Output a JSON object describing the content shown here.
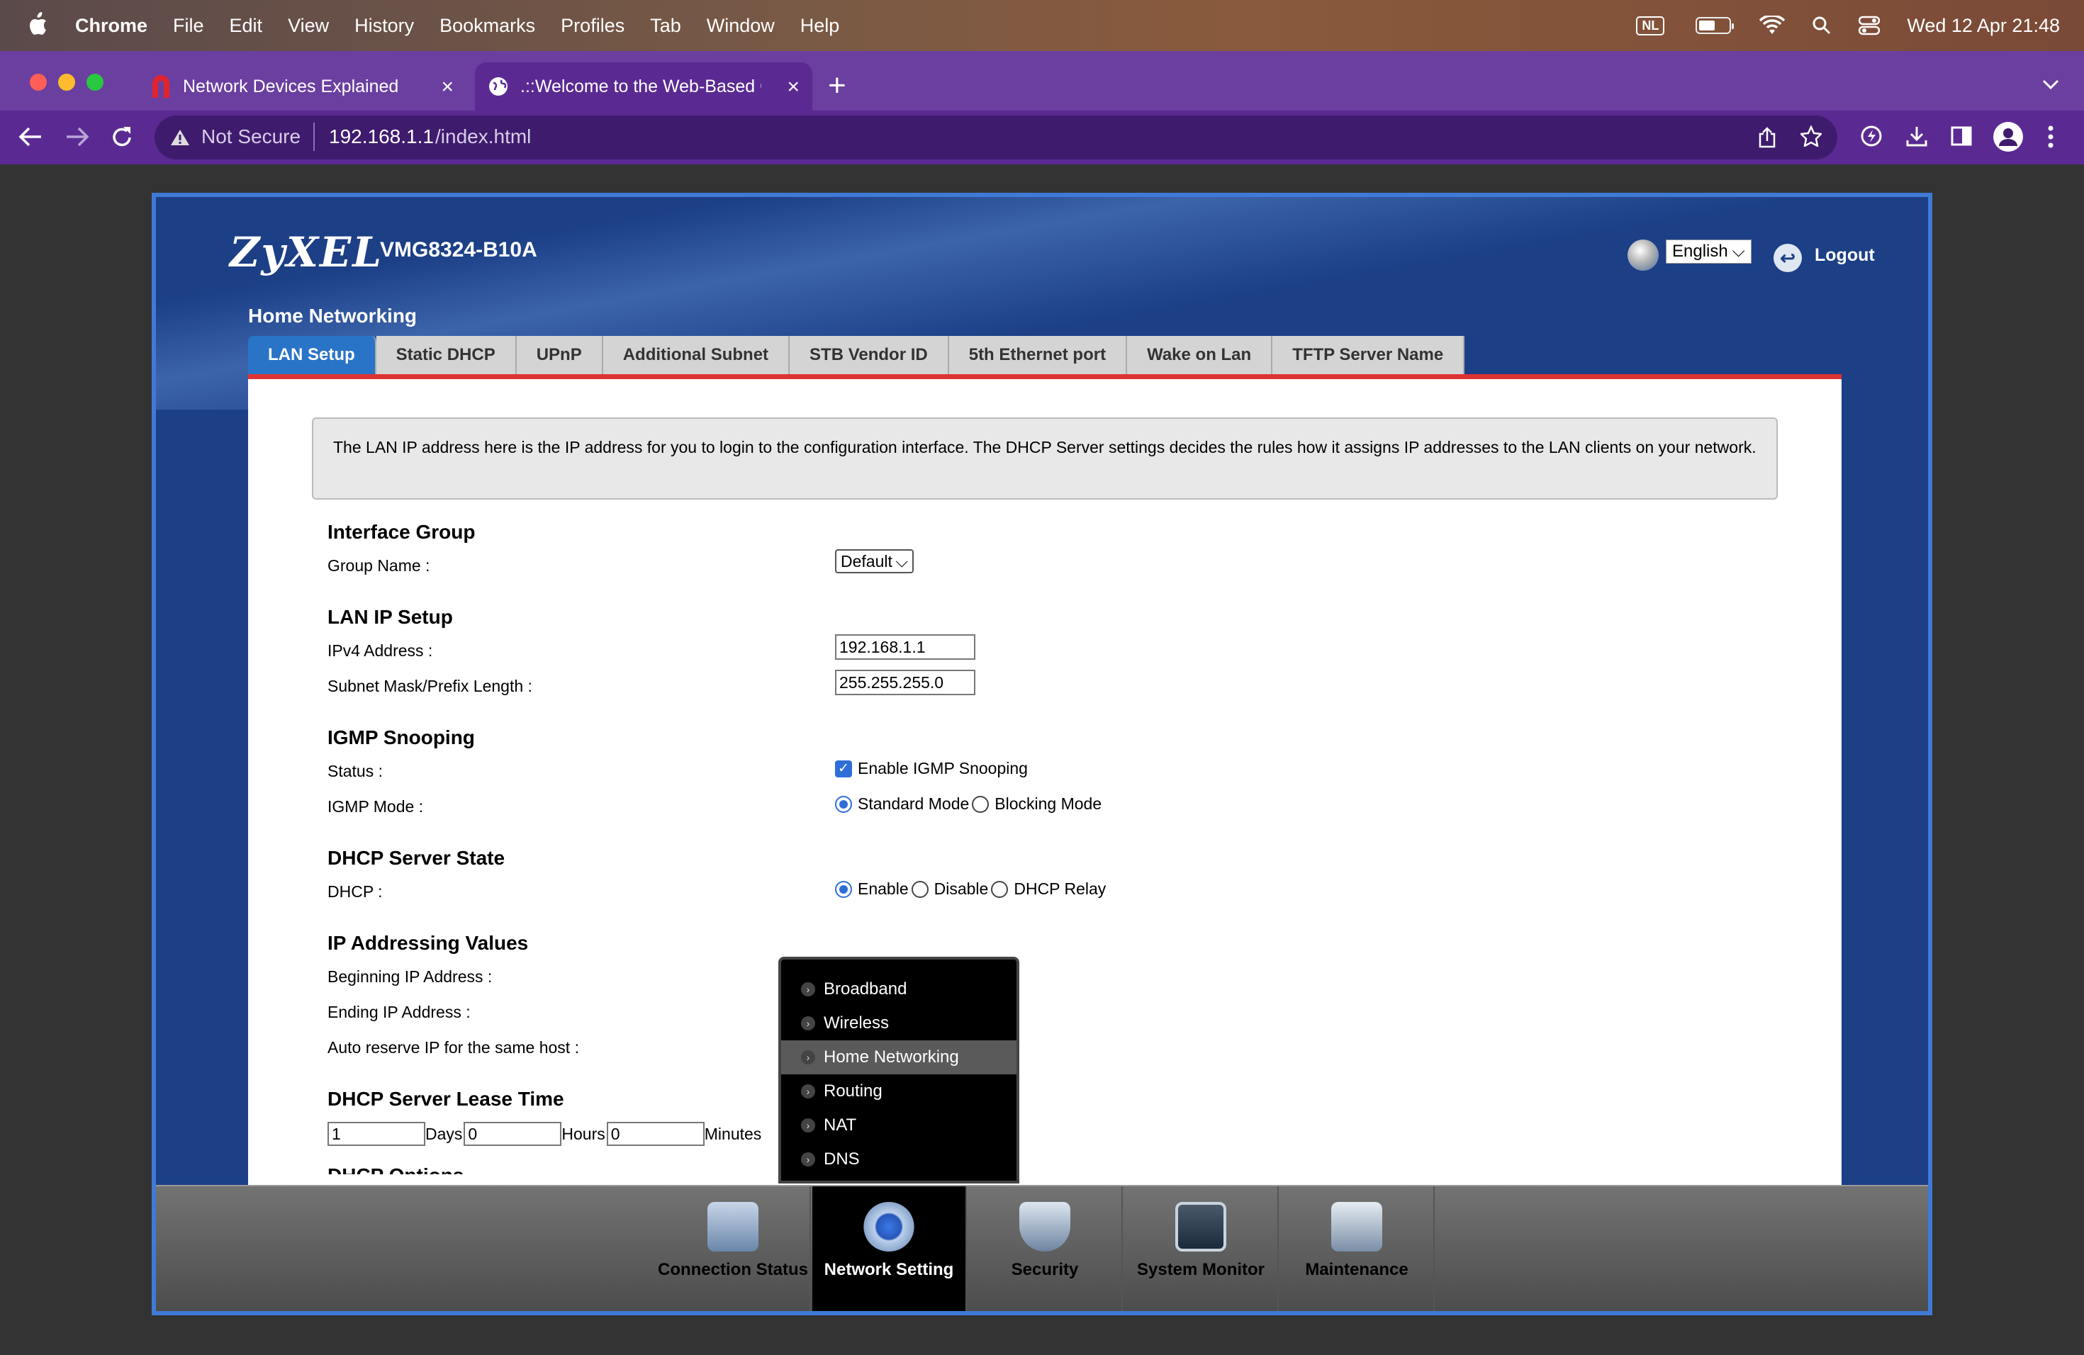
{
  "menubar": {
    "app": "Chrome",
    "items": [
      "File",
      "Edit",
      "View",
      "History",
      "Bookmarks",
      "Profiles",
      "Tab",
      "Window",
      "Help"
    ],
    "input_source": "NL",
    "datetime": "Wed 12 Apr  21:48"
  },
  "browser": {
    "tabs": [
      {
        "title": "Network Devices Explained"
      },
      {
        "title": ".::Welcome to the Web-Based C"
      }
    ],
    "security": "Not Secure",
    "url_host": "192.168.1.1",
    "url_path": "/index.html"
  },
  "router": {
    "brand": "ZyXEL",
    "model": "VMG8324-B10A",
    "language": "English",
    "logout": "Logout",
    "page_title": "Home Networking",
    "subtabs": [
      "LAN Setup",
      "Static DHCP",
      "UPnP",
      "Additional Subnet",
      "STB Vendor ID",
      "5th Ethernet port",
      "Wake on Lan",
      "TFTP Server Name"
    ],
    "info": "The LAN IP address here is the IP address for you to login to the configuration interface. The DHCP Server settings decides the rules how it assigns IP addresses to the LAN clients on your network.",
    "interface_group": {
      "heading": "Interface Group",
      "group_name_label": "Group Name :",
      "group_name": "Default"
    },
    "lan_ip": {
      "heading": "LAN IP Setup",
      "ipv4_label": "IPv4 Address :",
      "ipv4": "192.168.1.1",
      "mask_label": "Subnet Mask/Prefix Length :",
      "mask": "255.255.255.0"
    },
    "igmp": {
      "heading": "IGMP Snooping",
      "status_label": "Status :",
      "status_option": "Enable IGMP Snooping",
      "mode_label": "IGMP Mode :",
      "standard": "Standard Mode",
      "blocking": "Blocking Mode"
    },
    "dhcp_state": {
      "heading": "DHCP Server State",
      "dhcp_label": "DHCP :",
      "enable": "Enable",
      "disable": "Disable",
      "relay": "DHCP Relay"
    },
    "ip_values": {
      "heading": "IP Addressing Values",
      "begin_label": "Beginning IP Address :",
      "end_label": "Ending IP Address :",
      "reserve_label": "Auto reserve IP for the same host :"
    },
    "lease": {
      "heading": "DHCP Server Lease Time",
      "days": "1",
      "days_label": "Days",
      "hours": "0",
      "hours_label": "Hours",
      "minutes": "0",
      "minutes_label": "Minutes"
    },
    "options_heading": "DHCP Options",
    "popup_menu": [
      "Broadband",
      "Wireless",
      "Home Networking",
      "Routing",
      "NAT",
      "DNS"
    ],
    "bottom_nav": [
      "Connection Status",
      "Network Setting",
      "Security",
      "System Monitor",
      "Maintenance"
    ]
  }
}
